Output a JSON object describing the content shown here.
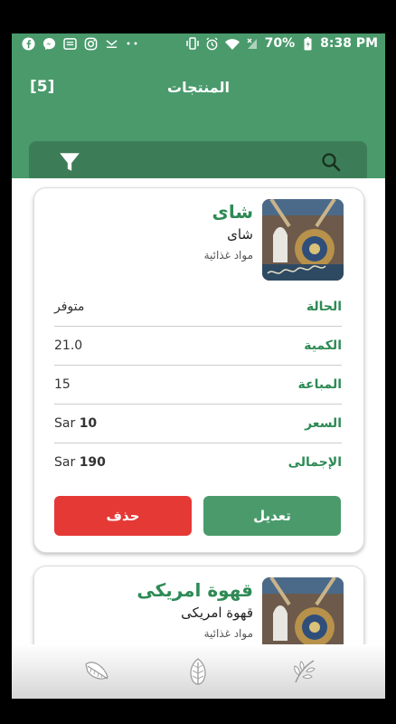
{
  "status_bar": {
    "battery": "70%",
    "time": "8:38 PM",
    "left_icons": [
      "facebook-icon",
      "messenger-icon",
      "app-icon",
      "instagram-icon",
      "mail-icon",
      "more-icon"
    ],
    "right_icons": [
      "vibrate-icon",
      "alarm-icon",
      "wifi-icon",
      "signal-icon",
      "battery-icon"
    ]
  },
  "header": {
    "title": "المنتجات",
    "count_badge": "[5]"
  },
  "search": {
    "search_icon": "search-icon",
    "filter_icon": "filter-icon"
  },
  "products": [
    {
      "name": "شاى",
      "subtitle": "شاى",
      "category": "مواد غذائية",
      "fields": [
        {
          "label": "الحالة",
          "value": "متوفر"
        },
        {
          "label": "الكمية",
          "value": "21.0"
        },
        {
          "label": "المباعة",
          "value": "15"
        },
        {
          "label": "السعر",
          "currency": "Sar",
          "amount": "10"
        },
        {
          "label": "الإجمالى",
          "currency": "Sar",
          "amount": "190"
        }
      ],
      "edit_label": "تعديل",
      "delete_label": "حذف"
    },
    {
      "name": "قهوة امريكى",
      "subtitle": "قهوة امريكى",
      "category": "مواد غذائية"
    }
  ],
  "bottom_nav": [
    "feather-icon",
    "leaf-icon",
    "wheat-icon"
  ],
  "colors": {
    "primary": "#4a9a6c",
    "primary_dark": "#3c7d57",
    "accent_text": "#2e8a55",
    "danger": "#e53935"
  }
}
